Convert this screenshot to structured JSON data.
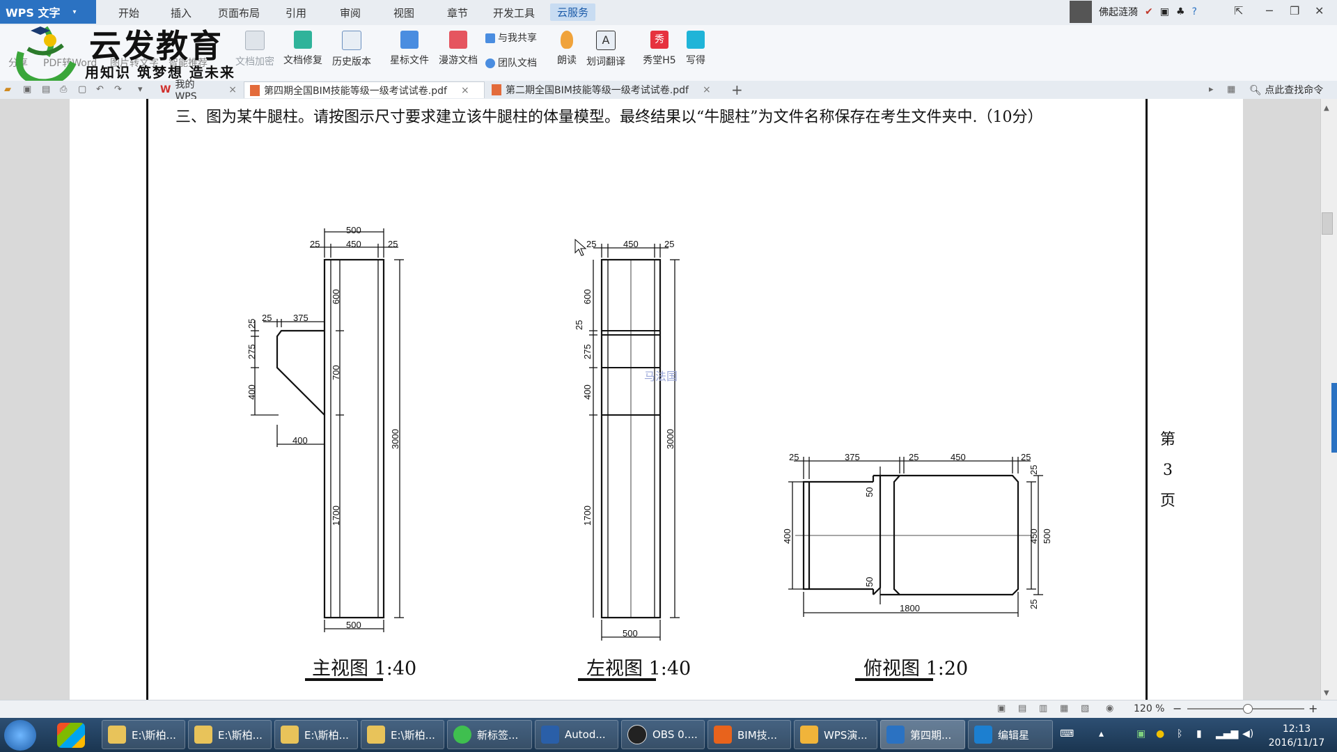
{
  "app": {
    "name": "WPS 文字",
    "drop": "▾"
  },
  "menu": [
    "开始",
    "插入",
    "页面布局",
    "引用",
    "审阅",
    "视图",
    "章节",
    "开发工具",
    "云服务"
  ],
  "user": {
    "name": "佛起涟漪"
  },
  "ribbon": {
    "hidden_left": [
      "分享",
      "PDF转Word",
      "图片转文字",
      "智能推荐"
    ],
    "buttons": [
      "文档加密",
      "文档修复",
      "历史版本",
      "星标文件",
      "漫游文档",
      "朗读",
      "划词翻译",
      "秀堂H5",
      "写得"
    ],
    "small": [
      "与我共享",
      "团队文档"
    ]
  },
  "watermark": {
    "brand": "云发教育",
    "slogan": "用知识 筑梦想 造未来"
  },
  "tabs": {
    "home": "我的WPS",
    "doc1": "第四期全国BIM技能等级一级考试试卷.pdf",
    "doc2": "第二期全国BIM技能等级一级考试试卷.pdf",
    "add": "+",
    "close": "×"
  },
  "search": {
    "placeholder": "点此查找命令"
  },
  "document": {
    "question": "三、图为某牛腿柱。请按图示尺寸要求建立该牛腿柱的体量模型。最终结果以“牛腿柱”为文件名称保存在考生文件夹中.（10分）",
    "views": {
      "front": "主视图  1:40",
      "left": "左视图  1:40",
      "top": "俯视图  1:20"
    },
    "page_side": [
      "第",
      "3",
      "页"
    ],
    "stamp": "马法国"
  },
  "dims": {
    "front": {
      "top500": "500",
      "top25a": "25",
      "top450": "450",
      "top25b": "25",
      "d600": "600",
      "d700": "700",
      "d1700": "1700",
      "d3000": "3000",
      "c25v": "25",
      "c275": "275",
      "c400": "400",
      "c25h": "25",
      "c375": "375",
      "c400b": "400",
      "bot500": "500"
    },
    "left": {
      "t25a": "25",
      "t450": "450",
      "t25b": "25",
      "d600": "600",
      "d25": "25",
      "d275": "275",
      "d400": "400",
      "d1700": "1700",
      "d3000": "3000",
      "b500": "500"
    },
    "top": {
      "t25a": "25",
      "t375": "375",
      "t25b": "25",
      "t450": "450",
      "t25c": "25",
      "r25a": "25",
      "r450": "450",
      "r500": "500",
      "r25b": "25",
      "l400": "400",
      "m50a": "50",
      "m50b": "50",
      "b1800": "1800"
    }
  },
  "status": {
    "zoom": "120 %",
    "minus": "−",
    "plus": "+"
  },
  "taskbar": {
    "items": [
      "E:\\斯柏...",
      "E:\\斯柏...",
      "E:\\斯柏...",
      "E:\\斯柏...",
      "新标签...",
      "Autod...",
      "OBS 0....",
      "BIM技...",
      "WPS演...",
      "第四期...",
      "编辑星"
    ],
    "time": "12:13",
    "date": "2016/11/17"
  },
  "colors": {
    "accent": "#2b72c2",
    "taskbar": "#1f3d5c",
    "pdf": "#e36b3b"
  }
}
